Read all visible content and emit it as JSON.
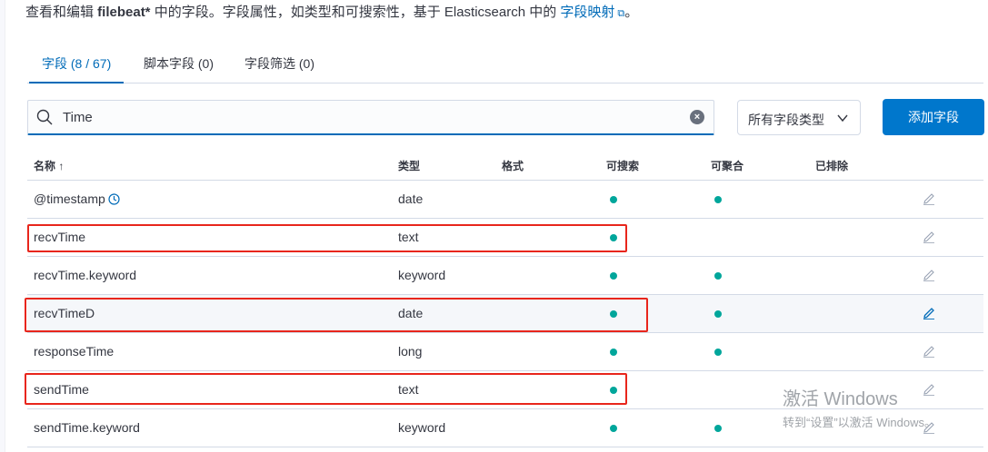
{
  "description": {
    "prefix": "查看和编辑 ",
    "index_pattern": "filebeat*",
    "middle": " 中的字段。字段属性，如类型和可搜索性，基于 Elasticsearch 中的 ",
    "link": "字段映射",
    "suffix": "。"
  },
  "tabs": [
    {
      "label": "字段 (8 / 67)",
      "active": true
    },
    {
      "label": "脚本字段 (0)",
      "active": false
    },
    {
      "label": "字段筛选 (0)",
      "active": false
    }
  ],
  "search": {
    "value": "Time"
  },
  "type_filter": {
    "label": "所有字段类型"
  },
  "add_field": {
    "label": "添加字段"
  },
  "columns": {
    "name": "名称 ↑",
    "type": "类型",
    "format": "格式",
    "searchable": "可搜索",
    "aggregatable": "可聚合",
    "excluded": "已排除"
  },
  "rows": [
    {
      "name": "@timestamp",
      "type": "date",
      "searchable": true,
      "aggregatable": true,
      "time_field": true
    },
    {
      "name": "recvTime",
      "type": "text",
      "searchable": true,
      "aggregatable": false
    },
    {
      "name": "recvTime.keyword",
      "type": "keyword",
      "searchable": true,
      "aggregatable": true
    },
    {
      "name": "recvTimeD",
      "type": "date",
      "searchable": true,
      "aggregatable": true
    },
    {
      "name": "responseTime",
      "type": "long",
      "searchable": true,
      "aggregatable": true
    },
    {
      "name": "sendTime",
      "type": "text",
      "searchable": true,
      "aggregatable": false
    },
    {
      "name": "sendTime.keyword",
      "type": "keyword",
      "searchable": true,
      "aggregatable": true
    }
  ],
  "watermark": {
    "line1": "激活 Windows",
    "line2": "转到“设置”以激活 Windows。"
  },
  "colors": {
    "accent": "#006bb8",
    "primary_button": "#0077cc",
    "dot": "#00a69b",
    "highlight_box": "#e8261c"
  }
}
